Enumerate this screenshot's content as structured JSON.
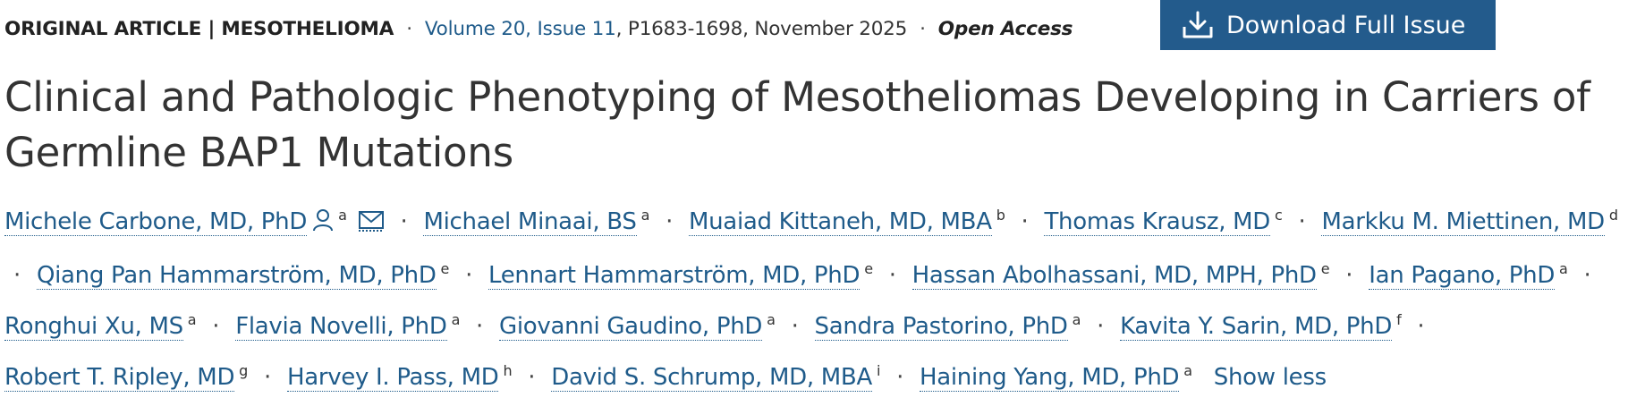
{
  "article_meta": {
    "type": "ORIGINAL ARTICLE | MESOTHELIOMA",
    "separator": "·",
    "issue_link": "Volume 20, Issue 11",
    "pages_date": ", P1683-1698, November 2025",
    "access": "Open Access"
  },
  "download_button": {
    "label": "Download Full Issue",
    "icon": "download-icon"
  },
  "title": "Clinical and Pathologic Phenotyping of Mesotheliomas Developing in Carriers of Germline BAP1 Mutations",
  "authors": [
    {
      "name": "Michele Carbone, MD, PhD",
      "affiliation": "a",
      "icons": [
        "person-icon",
        "email-icon"
      ]
    },
    {
      "name": "Michael Minaai, BS",
      "affiliation": "a"
    },
    {
      "name": "Muaiad Kittaneh, MD, MBA",
      "affiliation": "b"
    },
    {
      "name": "Thomas Krausz, MD",
      "affiliation": "c"
    },
    {
      "name": "Markku M. Miettinen, MD",
      "affiliation": "d"
    },
    {
      "name": "Qiang Pan Hammarström, MD, PhD",
      "affiliation": "e"
    },
    {
      "name": "Lennart Hammarström, MD, PhD",
      "affiliation": "e"
    },
    {
      "name": "Hassan Abolhassani, MD, MPH, PhD",
      "affiliation": "e"
    },
    {
      "name": "Ian Pagano, PhD",
      "affiliation": "a"
    },
    {
      "name": "Ronghui Xu, MS",
      "affiliation": "a"
    },
    {
      "name": "Flavia Novelli, PhD",
      "affiliation": "a"
    },
    {
      "name": "Giovanni Gaudino, PhD",
      "affiliation": "a"
    },
    {
      "name": "Sandra Pastorino, PhD",
      "affiliation": "a"
    },
    {
      "name": "Kavita Y. Sarin, MD, PhD",
      "affiliation": "f"
    },
    {
      "name": "Robert T. Ripley, MD",
      "affiliation": "g"
    },
    {
      "name": "Harvey I. Pass, MD",
      "affiliation": "h"
    },
    {
      "name": "David S. Schrump, MD, MBA",
      "affiliation": "i"
    },
    {
      "name": "Haining Yang, MD, PhD",
      "affiliation": "a"
    }
  ],
  "show_less": "Show less",
  "colors": {
    "link": "#1f5b8a",
    "button_bg": "#235b8c",
    "text": "#333333"
  }
}
